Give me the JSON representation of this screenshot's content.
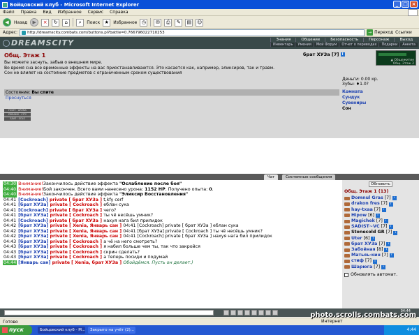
{
  "window": {
    "title": "Бойцовский клуб - Microsoft Internet Explorer"
  },
  "menu": [
    "Файл",
    "Правка",
    "Вид",
    "Избранное",
    "Сервис",
    "Справка"
  ],
  "toolbar": {
    "back": "Назад",
    "search": "Поиск",
    "favorites": "Избранное"
  },
  "address": {
    "label": "Адрес:",
    "url": "http://dreamscity.combats.com/buttons.pl?battle=0.766796022710253",
    "go": "Переход",
    "links": "Ссылки"
  },
  "game": {
    "logo": "DREAMSCITY",
    "topnav": [
      "Знания",
      "Общение",
      "Безопасность",
      "Персонаж",
      "Выход"
    ],
    "subnav": [
      "Инвентарь",
      "Умения",
      "Мой Форум",
      "Отчет о переводах",
      "Подарки",
      "Анкета"
    ],
    "location": {
      "title": "Общ. Этаж 1",
      "lines": [
        "Вы можете заснуть, забыв о внешнем мире.",
        "Во время сна все временные эффекты на вас приостанавливаются. Это касается как, например, эликсиров, так и травм.",
        "Сон не влияет на состояние предметов с ограниченным сроком существования"
      ]
    },
    "player": {
      "name": "брат ХУЗа",
      "level": "[7]",
      "info": "i"
    },
    "minimap": {
      "line1": "▲ Общежитие",
      "line2": "Общ. Этаж 2"
    },
    "money": {
      "money_label": "Деньги: 0.00 кр.",
      "teeth_label": "Зубы: ♦1.0?"
    },
    "state": {
      "label": "Состояние:",
      "value": "Вы спите",
      "wakeup": "Проснуться"
    },
    "rooms": {
      "items": [
        "Комната",
        "Сундук",
        "Сувениры"
      ],
      "current": "Сон"
    },
    "badges": [
      "FIGHT · ARENA",
      "DREAMS · CITY",
      "SAVE · SOLS"
    ],
    "chat_tabs": [
      "Чат",
      "Системные сообщения"
    ],
    "chat": [
      {
        "t": "04:30",
        "hl": true,
        "parts": [
          [
            "warn",
            "Внимание!"
          ],
          [
            "",
            "Закончилось действие эффекта "
          ],
          [
            "b",
            "\"Ослабление после боя\""
          ]
        ]
      },
      {
        "t": "04:40",
        "hl": true,
        "parts": [
          [
            "warn",
            "Внимание!"
          ],
          [
            "",
            "Бой закончен. Всего вами нанесено урона: "
          ],
          [
            "b",
            "1152 HP"
          ],
          [
            "",
            ". Получено опыта: "
          ],
          [
            "b",
            "0"
          ],
          [
            "",
            "."
          ]
        ]
      },
      {
        "t": "04:40",
        "hl": true,
        "parts": [
          [
            "warn",
            "Внимание!"
          ],
          [
            "",
            "Закончилось действие эффекта "
          ],
          [
            "b",
            "\"Эликсир Восстановления\""
          ]
        ]
      },
      {
        "t": "04:41",
        "hl": false,
        "parts": [
          [
            "lnkb",
            "[Cockroach]"
          ],
          [
            "prv",
            " private [ брат ХУЗа ] "
          ],
          [
            "",
            "t,kfy cerf"
          ]
        ]
      },
      {
        "t": "04:41",
        "hl": false,
        "parts": [
          [
            "lnkb",
            "[брат ХУЗа]"
          ],
          [
            "prv",
            " private [ Cockroach ] "
          ],
          [
            "",
            "еблан сука"
          ]
        ]
      },
      {
        "t": "04:41",
        "hl": false,
        "parts": [
          [
            "lnkb",
            "[Cockroach]"
          ],
          [
            "prv",
            " private [ брат ХУЗа ] "
          ],
          [
            "",
            "чего?"
          ]
        ]
      },
      {
        "t": "04:41",
        "hl": false,
        "parts": [
          [
            "lnkb",
            "[брат ХУЗа]"
          ],
          [
            "prv",
            " private [ Cockroach ] "
          ],
          [
            "",
            "ты чё несёшь умник?"
          ]
        ]
      },
      {
        "t": "04:41",
        "hl": false,
        "parts": [
          [
            "lnkb",
            "[Cockroach]"
          ],
          [
            "prv",
            " private [ брат ХУЗа ] "
          ],
          [
            "",
            "нахуя нага бил прилидок"
          ]
        ]
      },
      {
        "t": "04:42",
        "hl": false,
        "parts": [
          [
            "lnkb",
            "[брат ХУЗа]"
          ],
          [
            "prv",
            " private [ Xenia, Январь сан ] "
          ],
          [
            "",
            "04:41 [Cockroach] private [ брат ХУЗа ] еблан сука"
          ]
        ]
      },
      {
        "t": "04:42",
        "hl": false,
        "parts": [
          [
            "lnkb",
            "[брат ХУЗа]"
          ],
          [
            "prv",
            " private [ Xenia, Январь сан ] "
          ],
          [
            "",
            "04:41 [брат ХУЗа] private [ Cockroach ] ты чё несёшь умник?"
          ]
        ]
      },
      {
        "t": "04:42",
        "hl": false,
        "parts": [
          [
            "lnkb",
            "[брат ХУЗа]"
          ],
          [
            "prv",
            " private [ Xenia, Январь сан ] "
          ],
          [
            "",
            "04:41 [Cockroach] private [ брат ХУЗа ] нахуя нага бил прилидок"
          ]
        ]
      },
      {
        "t": "04:43",
        "hl": false,
        "parts": [
          [
            "lnkb",
            "[брат ХУЗа]"
          ],
          [
            "prv",
            " private [ Cockroach ] "
          ],
          [
            "",
            "а чё на него смотреть?"
          ]
        ]
      },
      {
        "t": "04:43",
        "hl": false,
        "parts": [
          [
            "lnkb",
            "[брат ХУЗа]"
          ],
          [
            "prv",
            " private [ Cockroach ] "
          ],
          [
            "",
            "я набил больше чем ты, так что закройся"
          ]
        ]
      },
      {
        "t": "04:43",
        "hl": false,
        "parts": [
          [
            "lnkb",
            "[брат ХУЗа]"
          ],
          [
            "prv",
            " private [ Cockroach ] "
          ],
          [
            "",
            "скрин сделать?"
          ]
        ]
      },
      {
        "t": "04:43",
        "hl": false,
        "parts": [
          [
            "lnkb",
            "[брат ХУЗа]"
          ],
          [
            "prv",
            " private [ Cockroach ] "
          ],
          [
            "",
            "а теперь посиди и подумай"
          ]
        ]
      },
      {
        "t": "04:44",
        "hl": true,
        "parts": [
          [
            "lnkb",
            "[Январь сан]"
          ],
          [
            "prv",
            " private [ Xenia, брат ХУЗа ] "
          ],
          [
            "grn",
            "Обойдёмся. Пусть он делает.)"
          ]
        ]
      }
    ],
    "users": {
      "refresh": "Обновить",
      "title": "Общ. Этаж 1 (13)",
      "list": [
        {
          "name": "Domnul Gras",
          "lvl": "[7]",
          "black": false
        },
        {
          "name": "drakon fres",
          "lvl": "[7]",
          "black": false
        },
        {
          "name": "hay-txaa",
          "lvl": "[7]",
          "black": false
        },
        {
          "name": "Hipow",
          "lvl": "[6]",
          "black": false
        },
        {
          "name": "Magichek",
          "lvl": "[7]",
          "black": false
        },
        {
          "name": "SADIST~VC",
          "lvl": "[7]",
          "black": false
        },
        {
          "name": "Stonecold GR",
          "lvl": "[7]",
          "black": true
        },
        {
          "name": "Uter",
          "lvl": "[6]",
          "black": false
        },
        {
          "name": "брат ХУЗа",
          "lvl": "[7]",
          "black": false
        },
        {
          "name": "Забойная",
          "lvl": "[8]",
          "black": false
        },
        {
          "name": "Матьяь-кин",
          "lvl": "[7]",
          "black": false
        },
        {
          "name": "стиф",
          "lvl": "[7]",
          "black": false
        },
        {
          "name": "Шарюга",
          "lvl": "[7]",
          "black": false
        }
      ],
      "auto": "Обновлять автомат."
    },
    "clock": "04:44"
  },
  "status": {
    "left": "Готово",
    "zone": "Интернет"
  },
  "taskbar": {
    "start": "пуск",
    "tasks": [
      "Бойцовский клуб - M...",
      "Закрыто на учёт (2)..."
    ],
    "tray": "4:44"
  },
  "watermark": "photo.scrolls.combats.com"
}
